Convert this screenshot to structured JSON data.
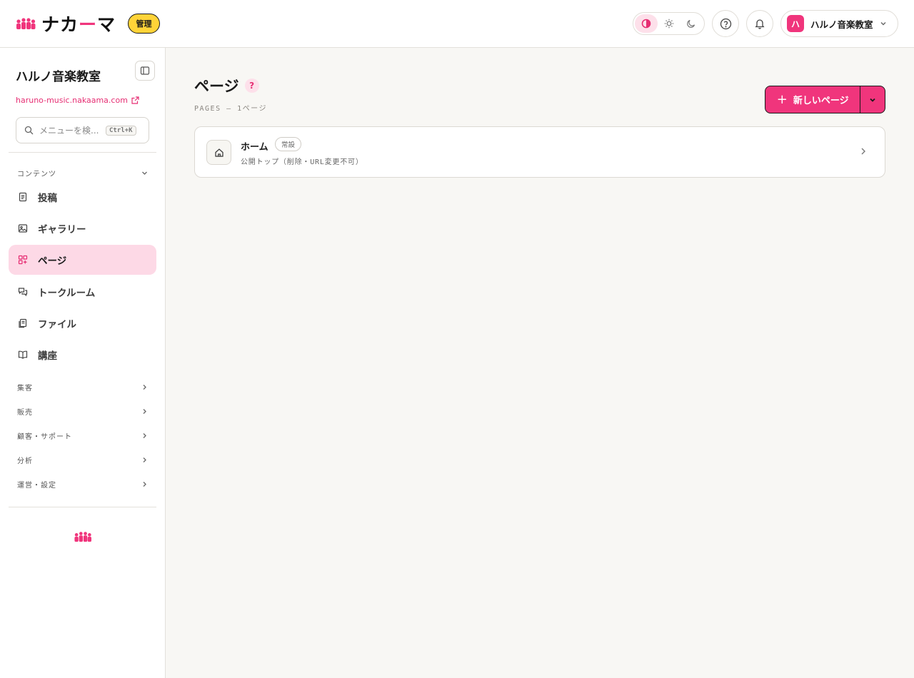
{
  "header": {
    "logo_text_a": "ナカ",
    "logo_text_b": "ー",
    "logo_text_c": "マ",
    "admin_badge": "管理",
    "account": {
      "avatar_letter": "ハ",
      "name": "ハルノ音楽教室"
    },
    "icons": {
      "theme_auto": "contrast-icon",
      "theme_light": "sun-icon",
      "theme_dark": "moon-icon",
      "help": "help-circle-icon",
      "notifications": "bell-icon"
    }
  },
  "sidebar": {
    "site_name": "ハルノ音楽教室",
    "site_url": "haruno-music.nakaama.com",
    "search": {
      "placeholder": "メニューを検...",
      "shortcut": "Ctrl+K"
    },
    "content_section": "コンテンツ",
    "items": [
      {
        "label": "投稿",
        "icon": "document-icon"
      },
      {
        "label": "ギャラリー",
        "icon": "image-icon"
      },
      {
        "label": "ページ",
        "icon": "grid-plus-icon",
        "active": true
      },
      {
        "label": "トークルーム",
        "icon": "chat-icon"
      },
      {
        "label": "ファイル",
        "icon": "files-icon"
      },
      {
        "label": "講座",
        "icon": "book-icon"
      }
    ],
    "sections": [
      "集客",
      "販売",
      "顧客・サポート",
      "分析",
      "運営・設定"
    ]
  },
  "main": {
    "title": "ページ",
    "help_mark": "?",
    "subtitle": "PAGES — 1ページ",
    "new_button": "新しいページ",
    "new_button_plus": "+",
    "pages": [
      {
        "title": "ホーム",
        "badge": "常設",
        "description": "公開トップ（削除・URL変更不可）"
      }
    ]
  },
  "colors": {
    "accent": "#f0357c",
    "active_bg": "#fdd9e6",
    "badge_yellow": "#ffd338"
  }
}
